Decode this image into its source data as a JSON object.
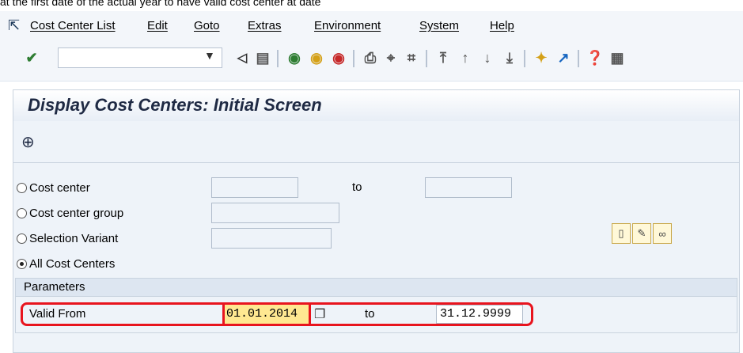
{
  "caption": "at the first date of the actual year to have valid cost center at date",
  "menu": {
    "items": [
      "Cost Center List",
      "Edit",
      "Goto",
      "Extras",
      "Environment",
      "System",
      "Help"
    ]
  },
  "toolbar": {
    "command_value": ""
  },
  "page": {
    "title": "Display Cost Centers: Initial Screen"
  },
  "selection": {
    "cost_center_label": "Cost center",
    "cost_center_group_label": "Cost center group",
    "selection_variant_label": "Selection Variant",
    "all_cost_centers_label": "All Cost Centers",
    "to_label": "to",
    "selected": "All Cost Centers"
  },
  "parameters": {
    "title": "Parameters",
    "valid_from_label": "Valid From",
    "valid_from_value": "01.01.2014",
    "to_label": "to",
    "valid_to_value": "31.12.9999"
  },
  "colors": {
    "highlight": "#e8141e",
    "field_active": "#ffe891"
  }
}
